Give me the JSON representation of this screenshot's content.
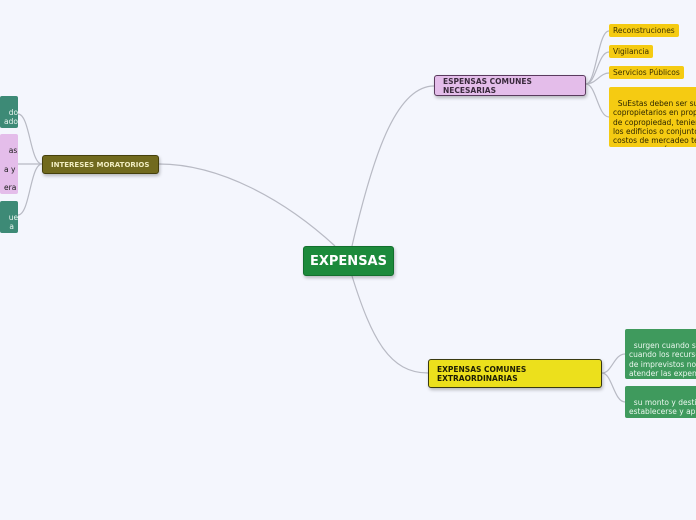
{
  "colors": {
    "background": "#f4f6fd",
    "main": "#1c8a3b",
    "necesarias": "#e4bdea",
    "extraordinarias": "#ece01c",
    "intereses": "#716a1e",
    "yellow_leaf": "#f5cb12",
    "green_leaf": "#3f9a5d",
    "teal_leaf": "#3d8a76",
    "link": "#b8bac4"
  },
  "main": {
    "label": "EXPENSAS"
  },
  "necesarias": {
    "label": "ESPENSAS COMUNES NECESARIAS",
    "children": [
      "Reconstruciones",
      "Vigilancia",
      "Servicios Públicos",
      "SuEstas deben ser sufragadas por los\ncopropietarios en proporción a los coeficientes\nde copropiedad, teniendo en cuenta que\nlos edificios o conjuntos deben garantizar los\ncostos de mercadeo teniendo en cuenta que toda\nexpensa común necesaria"
    ]
  },
  "extraordinarias": {
    "label": "EXPENSAS COMUNES\nEXTRAORDINARIAS",
    "children": [
      "surgen cuando se presentan situaciones\ncuando los recursos son insuficientes\nde imprevistos no contemplados, para\natender las expensas extraordinarias en\nque incurre la copropiedad",
      "su monto y destinación deben\nestablecerse y aprobarse en la Asamblea de\nPropietarios"
    ]
  },
  "intereses": {
    "label": "INTERESES MORATORIOS",
    "children": [
      "do\nado.",
      "as,\n\na y\n\nera",
      "ue\na"
    ]
  }
}
